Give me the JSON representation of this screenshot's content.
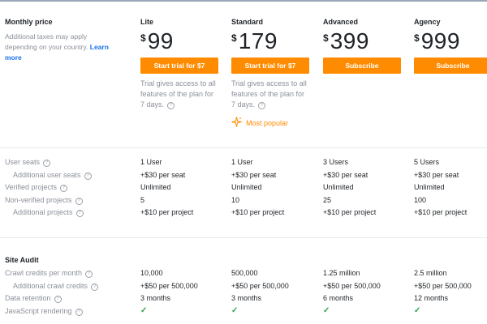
{
  "left": {
    "title": "Monthly price",
    "desc": "Additional taxes may apply depending on your country.",
    "learn_more": "Learn more"
  },
  "plans": [
    {
      "name": "Lite",
      "currency": "$",
      "price": "99",
      "button": "Start trial for $7",
      "note": "Trial gives access to all features of the plan for 7 days.",
      "popular": ""
    },
    {
      "name": "Standard",
      "currency": "$",
      "price": "179",
      "button": "Start trial for $7",
      "note": "Trial gives access to all features of the plan for 7 days.",
      "popular": "Most popular"
    },
    {
      "name": "Advanced",
      "currency": "$",
      "price": "399",
      "button": "Subscribe",
      "note": "",
      "popular": ""
    },
    {
      "name": "Agency",
      "currency": "$",
      "price": "999",
      "button": "Subscribe",
      "note": "",
      "popular": ""
    }
  ],
  "seats": {
    "rows": [
      {
        "label": "User seats",
        "indent": false,
        "values": [
          "1 User",
          "1 User",
          "3 Users",
          "5 Users"
        ]
      },
      {
        "label": "Additional user seats",
        "indent": true,
        "values": [
          "+$30 per seat",
          "+$30 per seat",
          "+$30 per seat",
          "+$30 per seat"
        ]
      },
      {
        "label": "Verified projects",
        "indent": false,
        "values": [
          "Unlimited",
          "Unlimited",
          "Unlimited",
          "Unlimited"
        ]
      },
      {
        "label": "Non-verified projects",
        "indent": false,
        "values": [
          "5",
          "10",
          "25",
          "100"
        ]
      },
      {
        "label": "Additional projects",
        "indent": true,
        "values": [
          "+$10 per project",
          "+$10 per project",
          "+$10 per project",
          "+$10 per project"
        ]
      }
    ]
  },
  "site_audit": {
    "title": "Site Audit",
    "rows": [
      {
        "label": "Crawl credits per month",
        "indent": false,
        "values": [
          "10,000",
          "500,000",
          "1.25 million",
          "2.5 million"
        ]
      },
      {
        "label": "Additional crawl credits",
        "indent": true,
        "values": [
          "+$50 per 500,000",
          "+$50 per 500,000",
          "+$50 per 500,000",
          "+$50 per 500,000"
        ]
      },
      {
        "label": "Data retention",
        "indent": false,
        "values": [
          "3 months",
          "3 months",
          "6 months",
          "12 months"
        ]
      },
      {
        "label": "JavaScript rendering",
        "indent": false,
        "values": [
          "✓",
          "✓",
          "✓",
          "✓"
        ]
      }
    ]
  },
  "icons": {
    "help": "question-circle-icon",
    "popular": "sparkle-icon",
    "check": "check-icon"
  },
  "colors": {
    "accent": "#ff8c00",
    "check": "#2e9e48",
    "link": "#1a73e8"
  }
}
